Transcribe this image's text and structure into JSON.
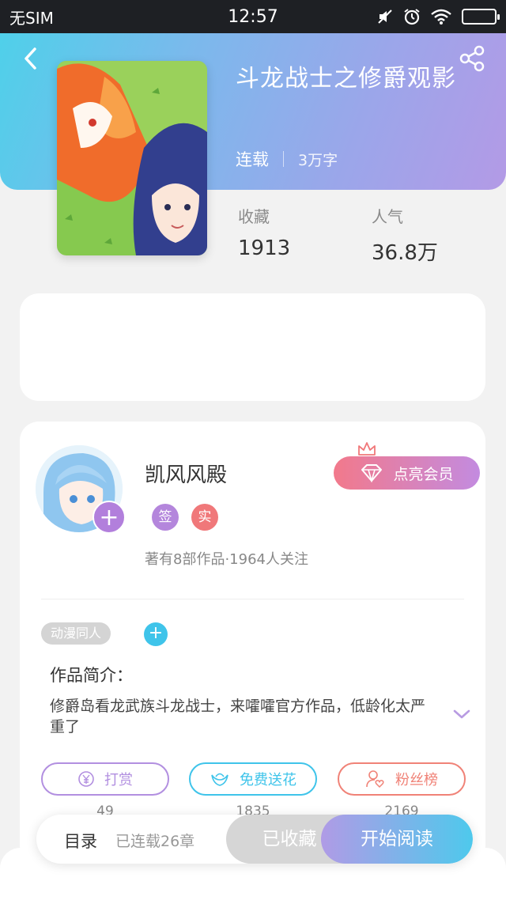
{
  "status_bar": {
    "carrier": "无SIM",
    "time": "12:57",
    "icons": [
      "mute-icon",
      "alarm-icon",
      "wifi-icon",
      "battery-icon"
    ]
  },
  "header": {
    "title": "斗龙战士之修爵观影",
    "status": "连载",
    "word_count": "3万字"
  },
  "stats": {
    "favorites_label": "收藏",
    "favorites_value": "1913",
    "popularity_label": "人气",
    "popularity_value": "36.8万"
  },
  "author": {
    "name": "凯风风殿",
    "badge_sign": "签",
    "badge_real": "实",
    "stats_text": "著有8部作品·1964人关注",
    "vip_button": "点亮会员"
  },
  "tags": {
    "chip": "动漫同人",
    "add": "+"
  },
  "intro": {
    "title": "作品简介：",
    "text": "修爵岛看龙武族斗龙战士，来嚯嚯官方作品，低龄化太严重了"
  },
  "actions": [
    {
      "label": "打赏",
      "count": "49",
      "color": "#b28fe0"
    },
    {
      "label": "免费送花",
      "count": "1835",
      "color": "#3fc4ea"
    },
    {
      "label": "粉丝榜",
      "count": "2169",
      "color": "#f08277"
    }
  ],
  "bottom_bar": {
    "toc_label": "目录",
    "toc_status": "已连载26章",
    "favorited_label": "已收藏",
    "read_label": "开始阅读"
  },
  "colors": {
    "header_gradient_start": "#4fd0ea",
    "header_gradient_end": "#b39ae6",
    "accent_purple": "#b27fdc",
    "accent_blue": "#3fc4ea",
    "accent_red": "#f08277"
  }
}
